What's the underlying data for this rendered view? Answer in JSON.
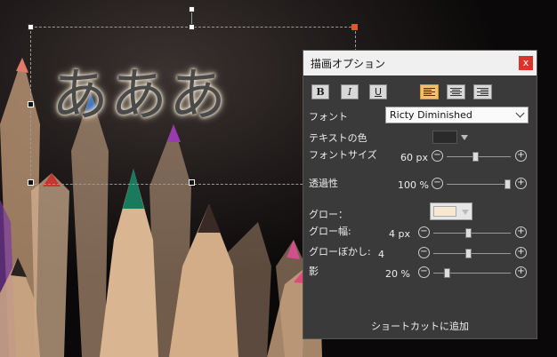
{
  "canvas": {
    "sample_text": "あああ"
  },
  "dialog": {
    "title": "描画オプション",
    "close_label": "x",
    "format": {
      "bold": "B",
      "italic": "I",
      "underline": "U"
    },
    "alignment_selected": "left",
    "font_label": "フォント",
    "font_value": "Ricty Diminished",
    "text_color_label": "テキストの色",
    "font_size_label": "フォントサイズ",
    "font_size_value": "60 px",
    "opacity_label": "透過性",
    "opacity_value": "100 %",
    "glow_label": "グロー：",
    "glow_color": "#f7e8d0",
    "glow_width_label": "グロー幅:",
    "glow_width_value": "4 px",
    "glow_blur_label": "グローぼかし:",
    "glow_blur_value": "4",
    "shadow_label": "影",
    "shadow_value": "20 %",
    "shortcut_label": "ショートカットに追加",
    "minus": "−",
    "plus": "+"
  },
  "sliders": {
    "font_size": 0.45,
    "opacity": 1.0,
    "glow_width": 0.45,
    "glow_blur": 0.45,
    "shadow": 0.15
  }
}
